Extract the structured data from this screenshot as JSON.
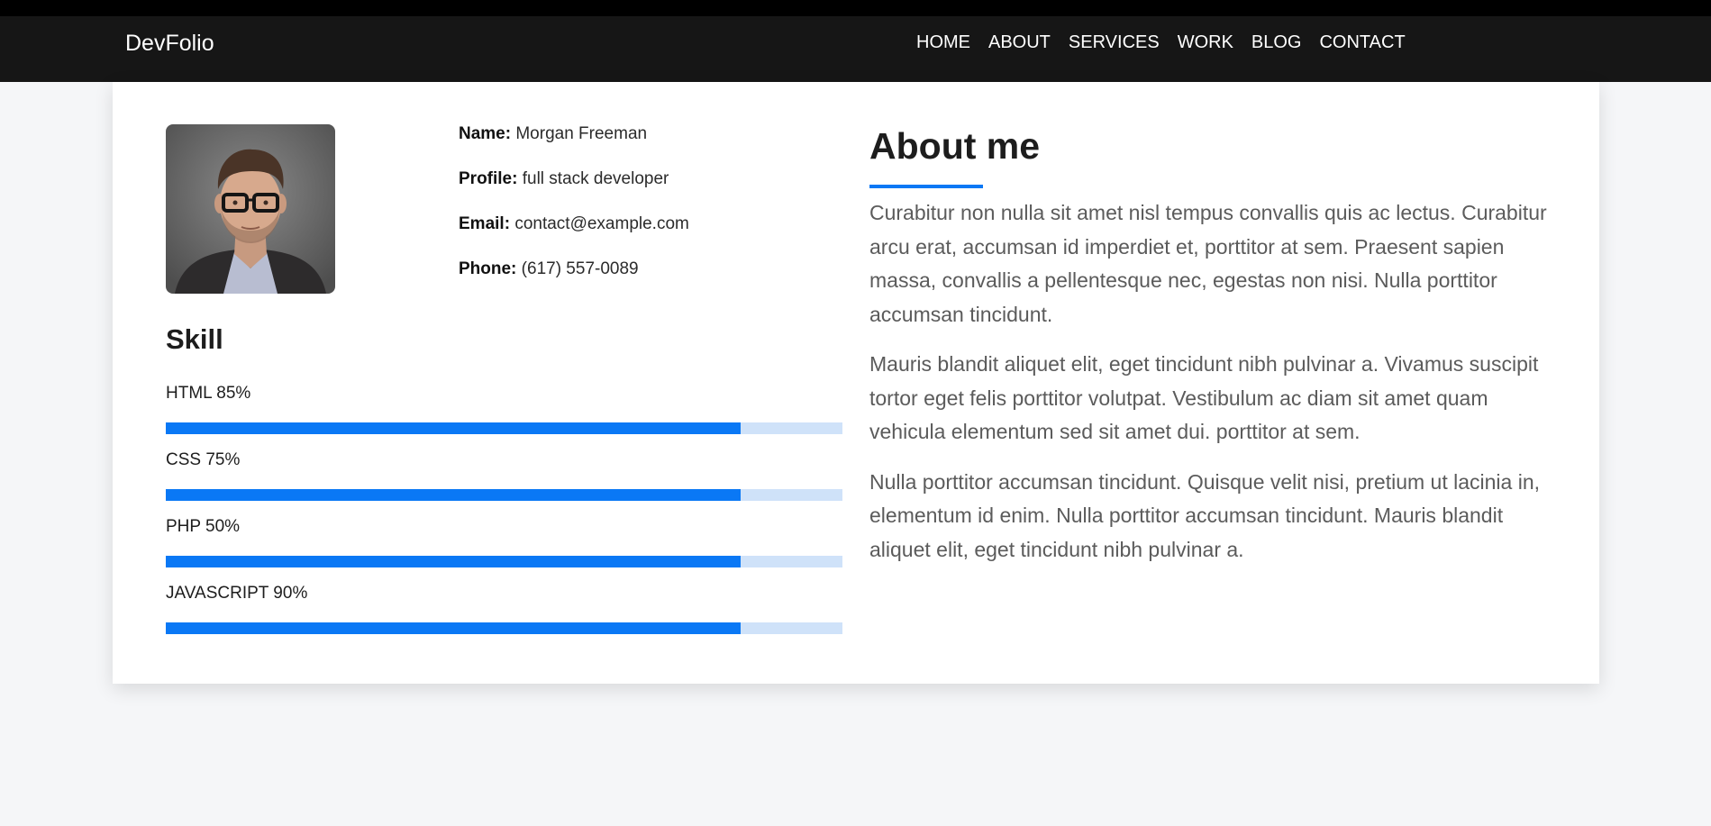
{
  "nav": {
    "brand": "DevFolio",
    "items": [
      {
        "label": "HOME"
      },
      {
        "label": "ABOUT"
      },
      {
        "label": "SERVICES"
      },
      {
        "label": "WORK"
      },
      {
        "label": "BLOG"
      },
      {
        "label": "CONTACT"
      }
    ]
  },
  "profile": {
    "photo_icon": "profile-photo",
    "name_label": "Name:",
    "name": "Morgan Freeman",
    "profile_label": "Profile:",
    "profile": "full stack developer",
    "email_label": "Email:",
    "email": "contact@example.com",
    "phone_label": "Phone:",
    "phone": "(617) 557-0089"
  },
  "skills": {
    "title": "Skill",
    "items": [
      {
        "label": "HTML 85%",
        "fill": 0.85
      },
      {
        "label": "CSS 75%",
        "fill": 0.85
      },
      {
        "label": "PHP 50%",
        "fill": 0.85
      },
      {
        "label": "JAVASCRIPT 90%",
        "fill": 0.85
      }
    ]
  },
  "about": {
    "title": "About me",
    "paragraphs": [
      "Curabitur non nulla sit amet nisl tempus convallis quis ac lectus. Curabitur arcu erat, accumsan id imperdiet et, porttitor at sem. Praesent sapien massa, convallis a pellentesque nec, egestas non nisi. Nulla porttitor accumsan tincidunt.",
      "Mauris blandit aliquet elit, eget tincidunt nibh pulvinar a. Vivamus suscipit tortor eget felis porttitor volutpat. Vestibulum ac diam sit amet quam vehicula elementum sed sit amet dui. porttitor at sem.",
      "Nulla porttitor accumsan tincidunt. Quisque velit nisi, pretium ut lacinia in, elementum id enim. Nulla porttitor accumsan tincidunt. Mauris blandit aliquet elit, eget tincidunt nibh pulvinar a."
    ]
  },
  "colors": {
    "navbar": "#161616",
    "accent": "#0a78f5",
    "bar_track": "#cfe2f9",
    "page_bg": "#f5f6f8"
  }
}
